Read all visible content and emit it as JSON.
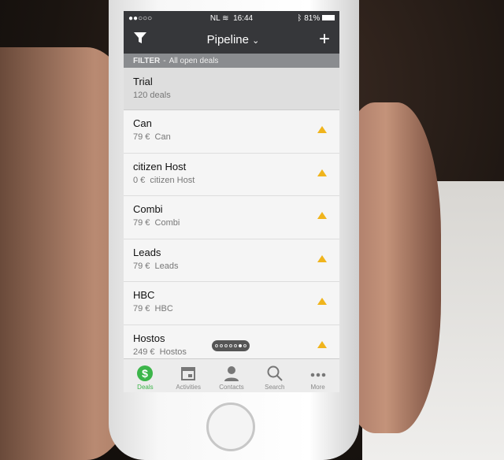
{
  "status": {
    "signal": "●●○○○",
    "carrier": "NL",
    "time": "16:44",
    "battery": "81%"
  },
  "nav": {
    "title": "Pipeline",
    "chevron": "⌄",
    "add": "+"
  },
  "filter": {
    "label": "FILTER",
    "sep": "-",
    "value": "All open deals"
  },
  "stage": {
    "name": "Trial",
    "count": "120 deals"
  },
  "deals": [
    {
      "name": "Can",
      "value": "79 €",
      "org": "Can"
    },
    {
      "name": "citizen Host",
      "value": "0 €",
      "org": "citizen Host"
    },
    {
      "name": "Combi",
      "value": "79 €",
      "org": "Combi"
    },
    {
      "name": "Leads",
      "value": "79 €",
      "org": "Leads"
    },
    {
      "name": "HBC",
      "value": "79 €",
      "org": "HBC"
    },
    {
      "name": "Hostos",
      "value": "249 €",
      "org": "Hostos"
    }
  ],
  "pager": {
    "pages": 7,
    "current": 6
  },
  "tabs": [
    {
      "label": "Deals",
      "icon": "dollar-icon"
    },
    {
      "label": "Activities",
      "icon": "calendar-icon"
    },
    {
      "label": "Contacts",
      "icon": "person-icon"
    },
    {
      "label": "Search",
      "icon": "search-icon"
    },
    {
      "label": "More",
      "icon": "more-icon"
    }
  ],
  "colors": {
    "accent": "#3cb54a",
    "warning": "#f0b41c",
    "header": "#36373a"
  }
}
